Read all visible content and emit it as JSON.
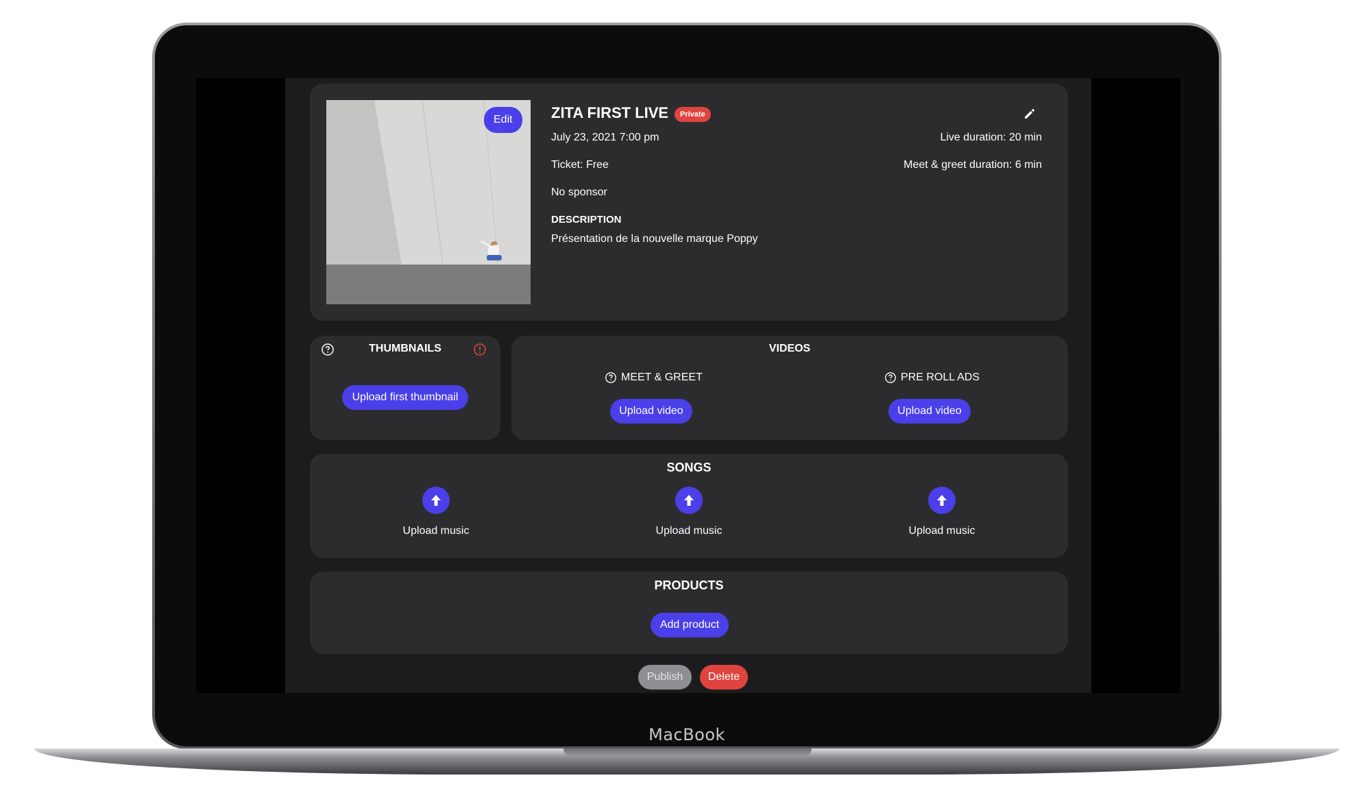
{
  "device": {
    "label": "MacBook"
  },
  "event": {
    "title": "ZITA FIRST LIVE",
    "visibility_badge": "Private",
    "edit_image_label": "Edit",
    "datetime": "July 23, 2021 7:00 pm",
    "ticket": "Ticket: Free",
    "sponsor": "No sponsor",
    "description_heading": "DESCRIPTION",
    "description": "Présentation de la nouvelle marque Poppy",
    "live_duration": "Live duration: 20 min",
    "meet_greet_duration": "Meet & greet duration: 6 min",
    "edit_icon": "pencil-icon"
  },
  "thumbnails": {
    "heading": "THUMBNAILS",
    "help_icon": "question-circle-icon",
    "warning_icon": "exclamation-circle-icon",
    "upload_label": "Upload first thumbnail"
  },
  "videos": {
    "heading": "VIDEOS",
    "items": [
      {
        "label": "MEET & GREET",
        "button": "Upload video"
      },
      {
        "label": "PRE ROLL ADS",
        "button": "Upload video"
      }
    ]
  },
  "songs": {
    "heading": "SONGS",
    "items": [
      {
        "label": "Upload music"
      },
      {
        "label": "Upload music"
      },
      {
        "label": "Upload music"
      }
    ]
  },
  "products": {
    "heading": "PRODUCTS",
    "add_label": "Add product"
  },
  "actions": {
    "publish_label": "Publish",
    "delete_label": "Delete"
  },
  "colors": {
    "accent": "#4a3fe8",
    "danger": "#e0443e",
    "card": "#2c2c2e",
    "page": "#1c1c1e",
    "disabled": "#8e8e93"
  }
}
